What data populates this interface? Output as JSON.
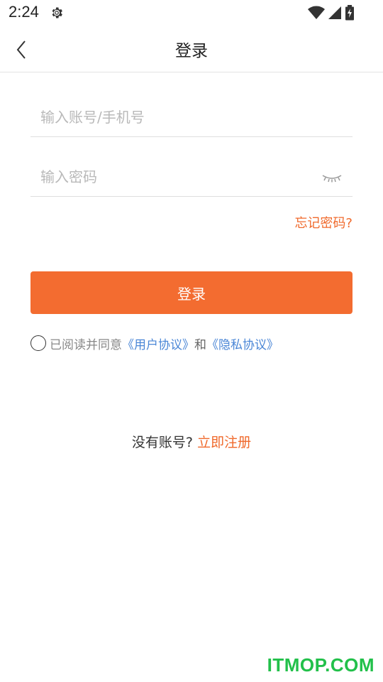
{
  "status_bar": {
    "time": "2:24",
    "icons": [
      "gear-icon",
      "wifi-icon",
      "cell-signal-icon",
      "battery-icon"
    ]
  },
  "nav": {
    "title": "登录",
    "back_icon": "chevron-left-icon"
  },
  "form": {
    "account_placeholder": "输入账号/手机号",
    "account_value": "",
    "password_placeholder": "输入密码",
    "password_value": "",
    "password_toggle_icon": "eye-closed-icon",
    "forgot_password": "忘记密码?",
    "login_button": "登录"
  },
  "agreement": {
    "checked": false,
    "text": "已阅读并同意",
    "user_agreement": "《用户协议》",
    "and": "和",
    "privacy_policy": "《隐私协议》"
  },
  "register": {
    "prompt": "没有账号?",
    "link": "立即注册"
  },
  "watermark": "ITMOP.COM",
  "colors": {
    "accent": "#f36c30",
    "link_blue": "#4a86d6",
    "watermark_green": "#22c04a"
  }
}
